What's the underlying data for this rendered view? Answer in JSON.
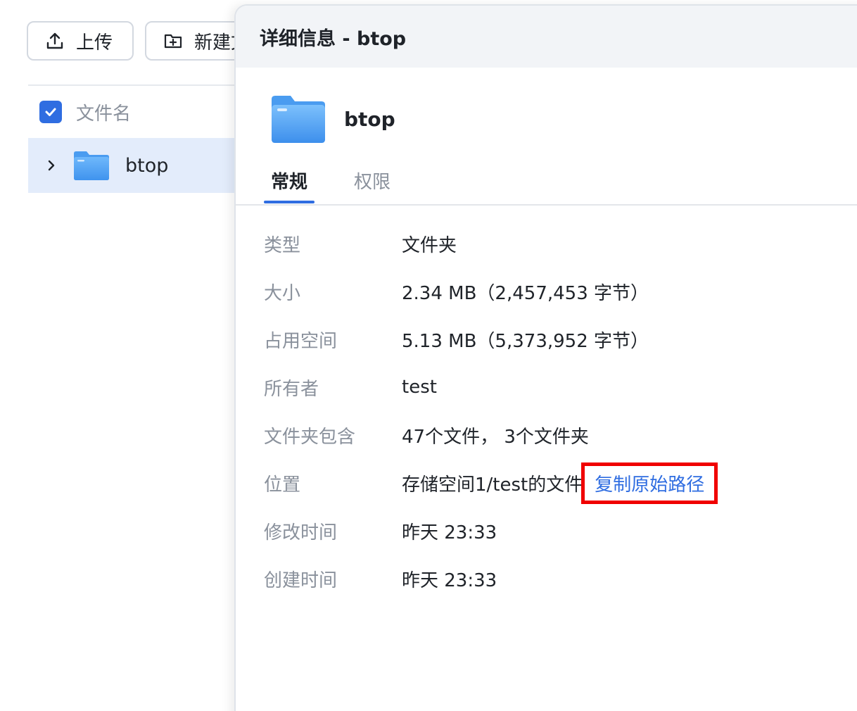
{
  "toolbar": {
    "upload_label": "上传",
    "new_label": "新建文"
  },
  "file_list": {
    "header_label": "文件名",
    "rows": [
      {
        "name": "btop"
      }
    ]
  },
  "details": {
    "title": "详细信息 - btop",
    "item_name": "btop",
    "tabs": [
      {
        "label": "常规",
        "active": true
      },
      {
        "label": "权限",
        "active": false
      }
    ],
    "properties": [
      {
        "label": "类型",
        "value": "文件夹"
      },
      {
        "label": "大小",
        "value": "2.34 MB（2,457,453 字节）"
      },
      {
        "label": "占用空间",
        "value": "5.13 MB（5,373,952 字节）"
      },
      {
        "label": "所有者",
        "value": "test"
      },
      {
        "label": "文件夹包含",
        "value": "47个文件， 3个文件夹"
      },
      {
        "label": "位置",
        "value": "存储空间1/test的文件",
        "link": "复制原始路径"
      },
      {
        "label": "修改时间",
        "value": "昨天 23:33"
      },
      {
        "label": "创建时间",
        "value": "昨天 23:33"
      }
    ]
  },
  "colors": {
    "accent": "#2f6de1",
    "highlight_box": "#f00000",
    "selected_row": "#e3ecfb",
    "folder": "#5aa9f5"
  }
}
